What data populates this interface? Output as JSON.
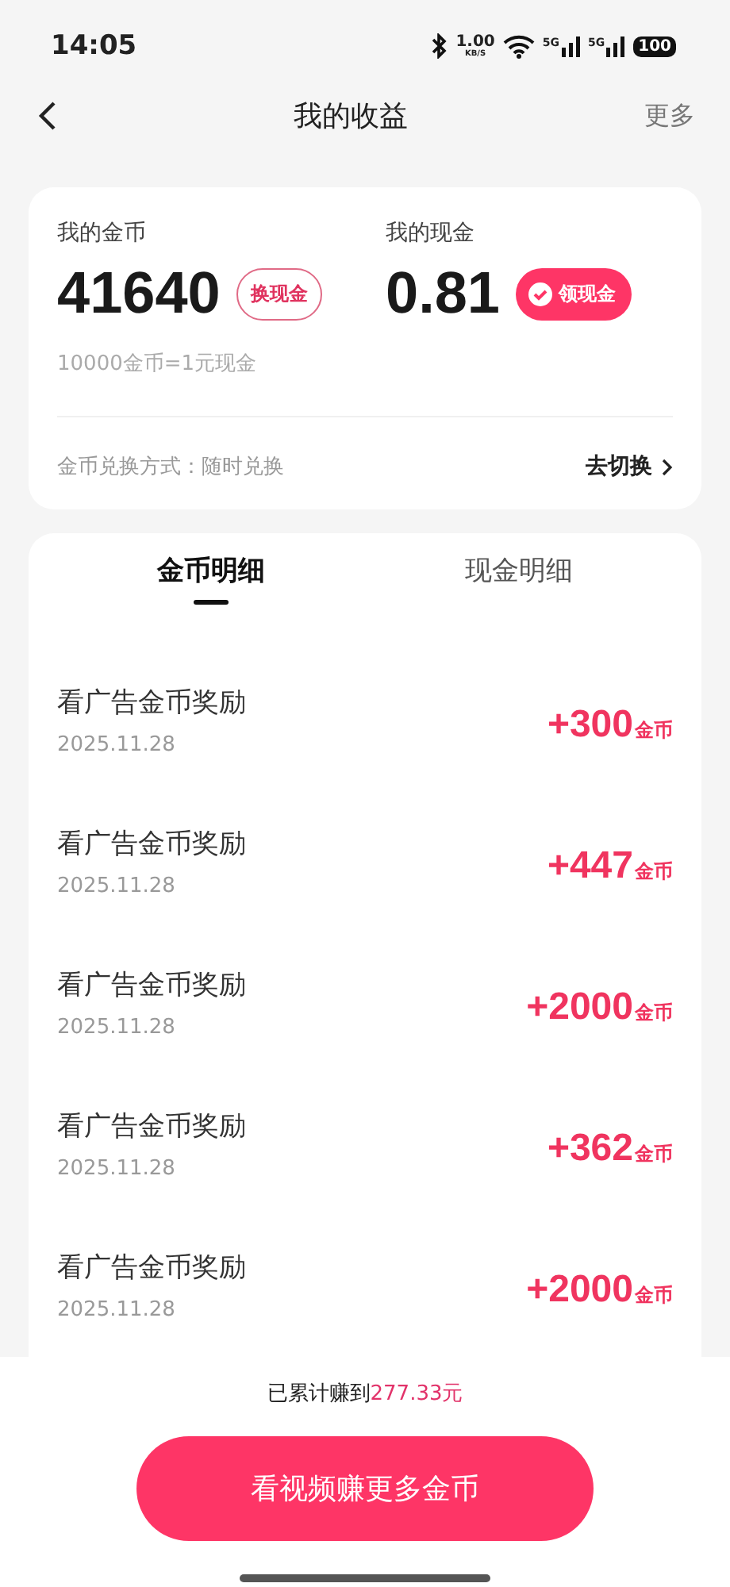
{
  "status_bar": {
    "time": "14:05",
    "speed": "1.00",
    "speed_unit": "KB/S",
    "network_1": "5G",
    "network_2": "5G",
    "battery": "100"
  },
  "header": {
    "title": "我的收益",
    "more": "更多"
  },
  "summary": {
    "coins_label": "我的金币",
    "coins": "41640",
    "coins_button": "换现金",
    "cash_label": "我的现金",
    "cash": "0.81",
    "cash_button": "领现金",
    "rate": "10000金币=1元现金",
    "exchange_mode": "金币兑换方式：随时兑换",
    "switch_link": "去切换"
  },
  "tabs": [
    {
      "label": "金币明细",
      "selected": true
    },
    {
      "label": "现金明细",
      "selected": false
    }
  ],
  "records": [
    {
      "title": "看广告金币奖励",
      "date": "2025.11.28",
      "amount": "+300",
      "unit": "金币"
    },
    {
      "title": "看广告金币奖励",
      "date": "2025.11.28",
      "amount": "+447",
      "unit": "金币"
    },
    {
      "title": "看广告金币奖励",
      "date": "2025.11.28",
      "amount": "+2000",
      "unit": "金币"
    },
    {
      "title": "看广告金币奖励",
      "date": "2025.11.28",
      "amount": "+362",
      "unit": "金币"
    },
    {
      "title": "看广告金币奖励",
      "date": "2025.11.28",
      "amount": "+2000",
      "unit": "金币"
    }
  ],
  "footer": {
    "total_prefix": "已累计赚到",
    "total": "277.33元",
    "button": "看视频赚更多金币"
  }
}
